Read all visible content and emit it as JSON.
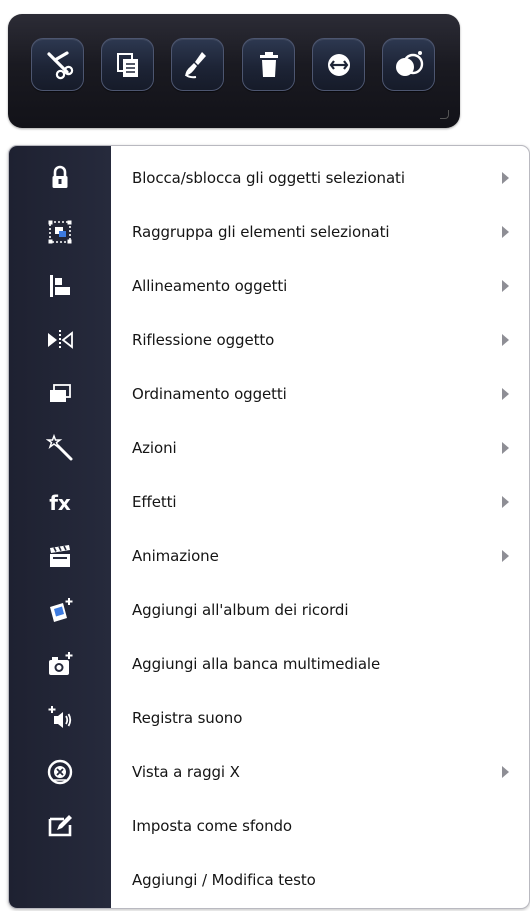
{
  "toolbar": {
    "buttons": [
      {
        "icon": "scissors-icon"
      },
      {
        "icon": "copy-icon"
      },
      {
        "icon": "brush-icon"
      },
      {
        "icon": "trash-icon"
      },
      {
        "icon": "link-icon"
      },
      {
        "icon": "intersect-circles-icon"
      }
    ]
  },
  "menu": {
    "items": [
      {
        "label": "Blocca/sblocca gli oggetti selezionati",
        "icon": "lock-icon",
        "submenu": true
      },
      {
        "label": "Raggruppa gli elementi selezionati",
        "icon": "group-icon",
        "submenu": true
      },
      {
        "label": "Allineamento oggetti",
        "icon": "align-icon",
        "submenu": true
      },
      {
        "label": "Riflessione oggetto",
        "icon": "mirror-icon",
        "submenu": true
      },
      {
        "label": "Ordinamento oggetti",
        "icon": "layers-icon",
        "submenu": true
      },
      {
        "label": "Azioni",
        "icon": "magic-wand-icon",
        "submenu": true
      },
      {
        "label": "Effetti",
        "icon": "fx-icon",
        "submenu": true
      },
      {
        "label": "Animazione",
        "icon": "clapperboard-icon",
        "submenu": true
      },
      {
        "label": "Aggiungi all'album dei ricordi",
        "icon": "add-album-icon",
        "submenu": false
      },
      {
        "label": "Aggiungi alla banca multimediale",
        "icon": "add-camera-icon",
        "submenu": false
      },
      {
        "label": "Registra suono",
        "icon": "add-sound-icon",
        "submenu": false
      },
      {
        "label": "Vista a raggi X",
        "icon": "xray-icon",
        "submenu": true
      },
      {
        "label": "Imposta come sfondo",
        "icon": "set-background-icon",
        "submenu": false
      },
      {
        "label": "Aggiungi / Modifica testo",
        "icon": "edit-text-icon",
        "submenu": false
      }
    ]
  },
  "colors": {
    "toolbar_bg": "#1a1a21",
    "button_bg": "#1d2436",
    "rail_bg": "#232637",
    "icon_white": "#ffffff",
    "icon_accent": "#3d7be0"
  }
}
